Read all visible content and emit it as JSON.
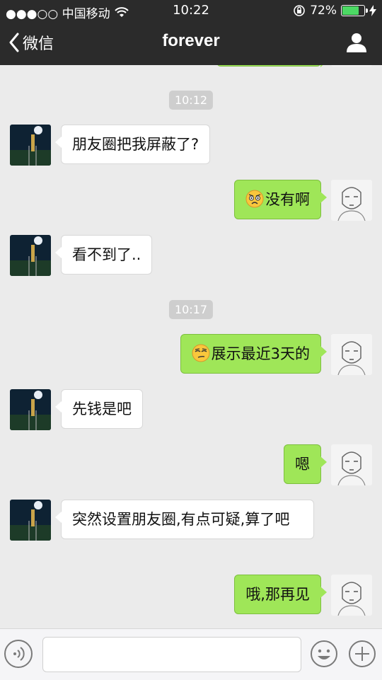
{
  "status_bar": {
    "carrier": "●●●○○ 中国移动",
    "time": "10:22",
    "battery": "72%",
    "battery_level": 0.72
  },
  "nav": {
    "back_label": "微信",
    "title": "forever"
  },
  "messages": [
    {
      "type": "time",
      "text": "10:12"
    },
    {
      "type": "in",
      "text": "朋友圈把我屏蔽了?"
    },
    {
      "type": "out",
      "text": "没有啊",
      "emoji": "angry-face-emoji"
    },
    {
      "type": "in",
      "text": "看不到了.."
    },
    {
      "type": "time",
      "text": "10:17"
    },
    {
      "type": "out",
      "text": "展示最近3天的",
      "emoji": "smirk-face-emoji"
    },
    {
      "type": "in",
      "text": "先钱是吧"
    },
    {
      "type": "out",
      "text": "嗯"
    },
    {
      "type": "in",
      "text": "突然设置朋友圈,有点可疑,算了吧"
    },
    {
      "type": "out",
      "text": "哦,那再见"
    }
  ],
  "colors": {
    "header_bg": "#2b2b2b",
    "chat_bg": "#ebebeb",
    "out_bubble": "#9fe658",
    "in_bubble": "#ffffff",
    "timestamp_bg": "#cecece"
  },
  "input_bar": {
    "icons": [
      "voice-icon",
      "emoji-icon",
      "plus-icon"
    ]
  }
}
